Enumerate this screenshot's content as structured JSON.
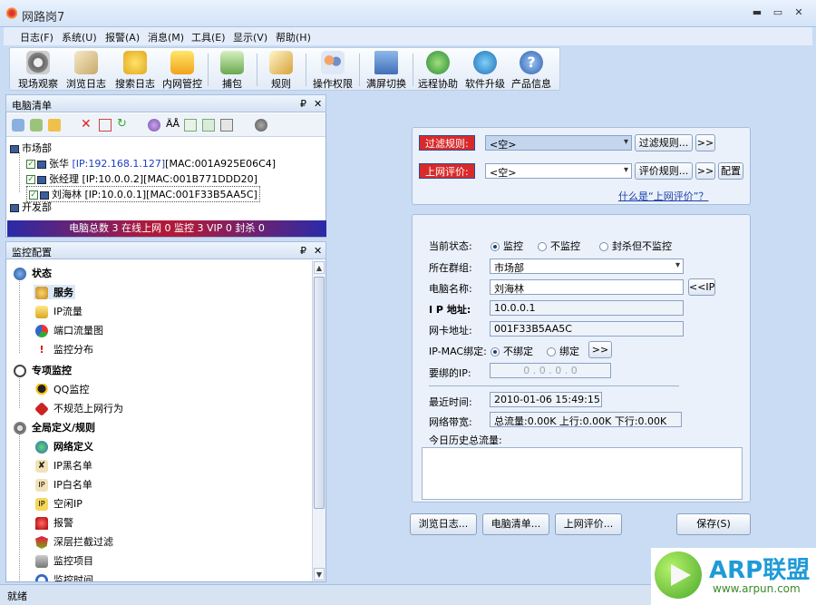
{
  "window": {
    "title": "网路岗7",
    "min": "▬",
    "max": "▭",
    "close": "✕"
  },
  "menu": [
    "日志(F)",
    "系统(U)",
    "报警(A)",
    "消息(M)",
    "工具(E)",
    "显示(V)",
    "帮助(H)"
  ],
  "toolbar": [
    {
      "label": "现场观察",
      "icon": "eye-icon"
    },
    {
      "label": "浏览日志",
      "icon": "browse-log-icon"
    },
    {
      "label": "搜索日志",
      "icon": "search-log-icon"
    },
    {
      "label": "内网管控",
      "icon": "lan-control-icon"
    },
    {
      "label": "捕包",
      "icon": "capture-icon"
    },
    {
      "label": "规则",
      "icon": "rule-icon"
    },
    {
      "label": "操作权限",
      "icon": "permission-icon"
    },
    {
      "label": "满屏切换",
      "icon": "fullscreen-icon"
    },
    {
      "label": "远程协助",
      "icon": "remote-icon"
    },
    {
      "label": "软件升级",
      "icon": "upgrade-icon"
    },
    {
      "label": "产品信息",
      "icon": "help-icon"
    }
  ],
  "pc_panel": {
    "title": "电脑清单",
    "pin": "₽",
    "close": "✕",
    "tree": {
      "group1": "市场部",
      "items": [
        {
          "name": "张华",
          "ip": "[IP:192.168.1.127]",
          "mac": "[MAC:001A925E06C4]"
        },
        {
          "name": "张经理",
          "ip": "[IP:10.0.0.2]",
          "mac": "[MAC:001B771DDD20]"
        },
        {
          "name": "刘海林",
          "ip": "[IP:10.0.0.1]",
          "mac": "[MAC:001F33B5AA5C]"
        }
      ],
      "group2": "开发部"
    },
    "summary": "电脑总数 3  在线上网 0  监控 3  VIP 0  封杀 0"
  },
  "cfg_panel": {
    "title": "监控配置",
    "sections": [
      {
        "label": "状态",
        "items": [
          "服务",
          "IP流量",
          "端口流量图",
          "监控分布"
        ]
      },
      {
        "label": "专项监控",
        "items": [
          "QQ监控",
          "不规范上网行为"
        ]
      },
      {
        "label": "全局定义/规则",
        "items": [
          "网络定义",
          "IP黑名单",
          "IP白名单",
          "空闲IP",
          "报警",
          "深层拦截过滤",
          "监控项目",
          "监控时间"
        ]
      }
    ]
  },
  "filter": {
    "rule_label": "过滤规则:",
    "rule_value": "<空>",
    "rule_btn": "过滤规则...",
    "more": ">>",
    "eval_label": "上网评价:",
    "eval_value": "<空>",
    "eval_btn": "评价规则...",
    "config_btn": "配置",
    "link": "什么是“上网评价”？"
  },
  "state": {
    "status_label": "当前状态:",
    "opt_monitor": "监控",
    "opt_nomonitor": "不监控",
    "opt_block": "封杀但不监控",
    "group_label": "所在群组:",
    "group_value": "市场部",
    "name_label": "电脑名称:",
    "name_value": "刘海林",
    "ip_btn": "<<IP",
    "ip_label": "I P 地址:",
    "ip_value": "10.0.0.1",
    "mac_label": "网卡地址:",
    "mac_value": "001F33B5AA5C",
    "bind_label": "IP-MAC绑定:",
    "bind_no": "不绑定",
    "bind_yes": "绑定",
    "bind_btn": ">>",
    "bindip_label": "要绑的IP:",
    "bindip_value": "0  .  0  .  0  .  0",
    "last_label": "最近时间:",
    "last_value": "2010-01-06 15:49:15",
    "bw_label": "网络带宽:",
    "bw_value": "总流量:0.00K 上行:0.00K 下行:0.00K",
    "hist_label": "今日历史总流量:"
  },
  "bottom": {
    "browse": "浏览日志...",
    "pclist": "电脑清单...",
    "eval": "上网评价...",
    "save": "保存(S)"
  },
  "status": "就绪",
  "logo": {
    "brand": "ARP联盟",
    "url": "www.arpun.com"
  }
}
